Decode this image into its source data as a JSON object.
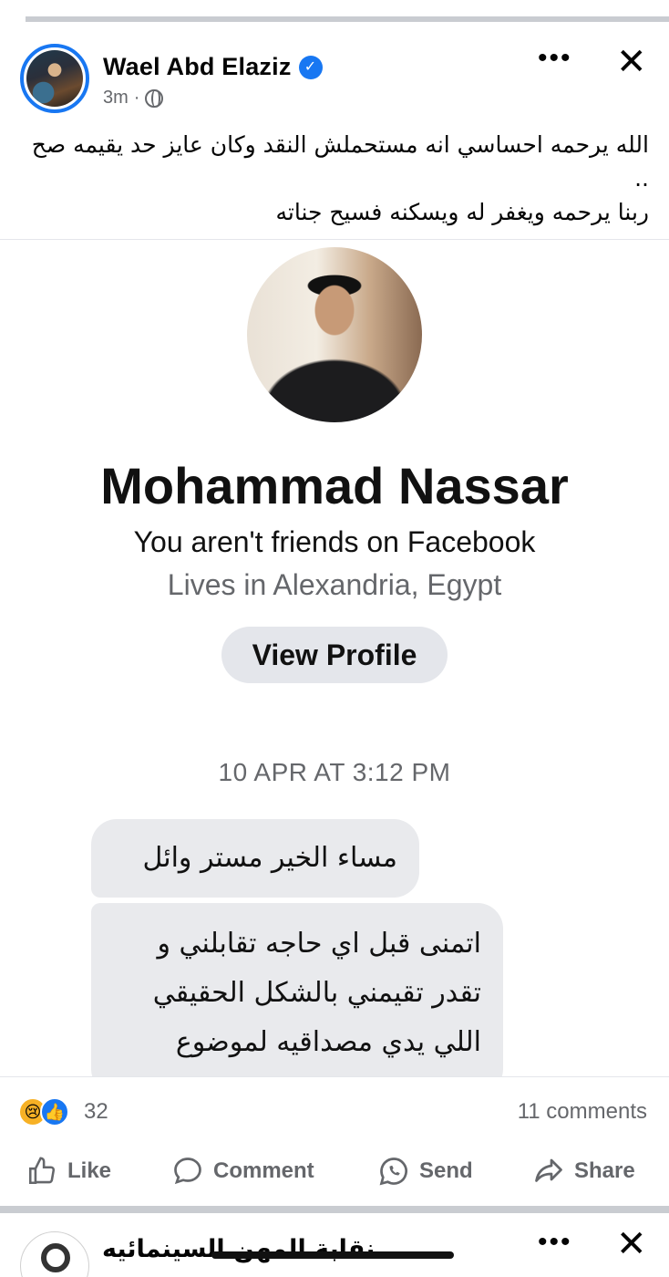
{
  "post": {
    "author": "Wael Abd Elaziz",
    "verified_icon": "verified-badge-icon",
    "time": "3m",
    "dot": "·",
    "audience_icon": "globe-icon",
    "more_label": "•••",
    "close_label": "✕",
    "text_lines": [
      "الله يرحمه احساسي انه مستحملش النقد وكان عايز حد يقيمه صح ..",
      "ربنا يرحمه ويغفر له ويسكنه فسيح جناته"
    ]
  },
  "screenshot": {
    "profile_name": "Mohammad Nassar",
    "friends_status": "You aren't friends on Facebook",
    "lives_in": "Lives in Alexandria, Egypt",
    "view_profile_label": "View Profile",
    "timestamp": "10 APR AT 3:12 PM",
    "message_1": "مساء الخير مستر وائل",
    "message_2_lines": [
      "اتمنى قبل اي حاجه تقابلني و",
      "تقدر تقيمني بالشكل الحقيقي",
      "اللي يدي مصداقيه لموضوع"
    ]
  },
  "reactions": {
    "icons": [
      "sad-reaction-icon",
      "like-reaction-icon"
    ],
    "count": "32",
    "comments": "11 comments"
  },
  "actions": {
    "like": "Like",
    "comment": "Comment",
    "send": "Send",
    "share": "Share"
  },
  "next_post": {
    "author": "نقابة المهن السينمائيه",
    "more_label": "•••",
    "close_label": "✕"
  },
  "colors": {
    "brand_blue": "#1877f2",
    "muted_text": "#65676b",
    "bubble_bg": "#e9eaed",
    "button_bg": "#e4e6eb"
  }
}
